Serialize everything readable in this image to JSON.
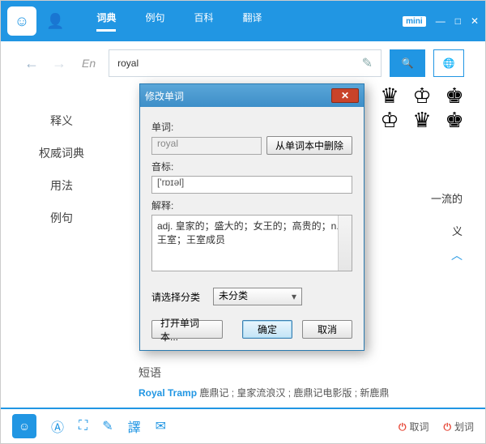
{
  "titlebar": {
    "tabs": [
      "词典",
      "例句",
      "百科",
      "翻译"
    ],
    "active_tab": 0,
    "mini": "mini"
  },
  "search": {
    "lang": "En",
    "value": "royal"
  },
  "sidebar": {
    "items": [
      "释义",
      "权威词典",
      "用法",
      "例句"
    ]
  },
  "content": {
    "side_text": "一流的",
    "side_text2": "义",
    "phrase_title": "短语",
    "phrase_link": "Royal Tramp",
    "phrase_rest": " 鹿鼎记 ; 皇家流浪汉 ; 鹿鼎记电影版 ; 新鹿鼎"
  },
  "bottombar": {
    "quci": "取词",
    "huaci": "划词"
  },
  "modal": {
    "title": "修改单词",
    "labels": {
      "word": "单词:",
      "phonetic": "音标:",
      "definition": "解释:",
      "category": "请选择分类"
    },
    "word_value": "royal",
    "delete_btn": "从单词本中删除",
    "phonetic_value": "['rɒɪəl]",
    "definition_value": "adj. 皇家的；盛大的；女王的；高贵的；n. 王室；王室成员",
    "category_value": "未分类",
    "buttons": {
      "open": "打开单词本...",
      "ok": "确定",
      "cancel": "取消"
    }
  }
}
